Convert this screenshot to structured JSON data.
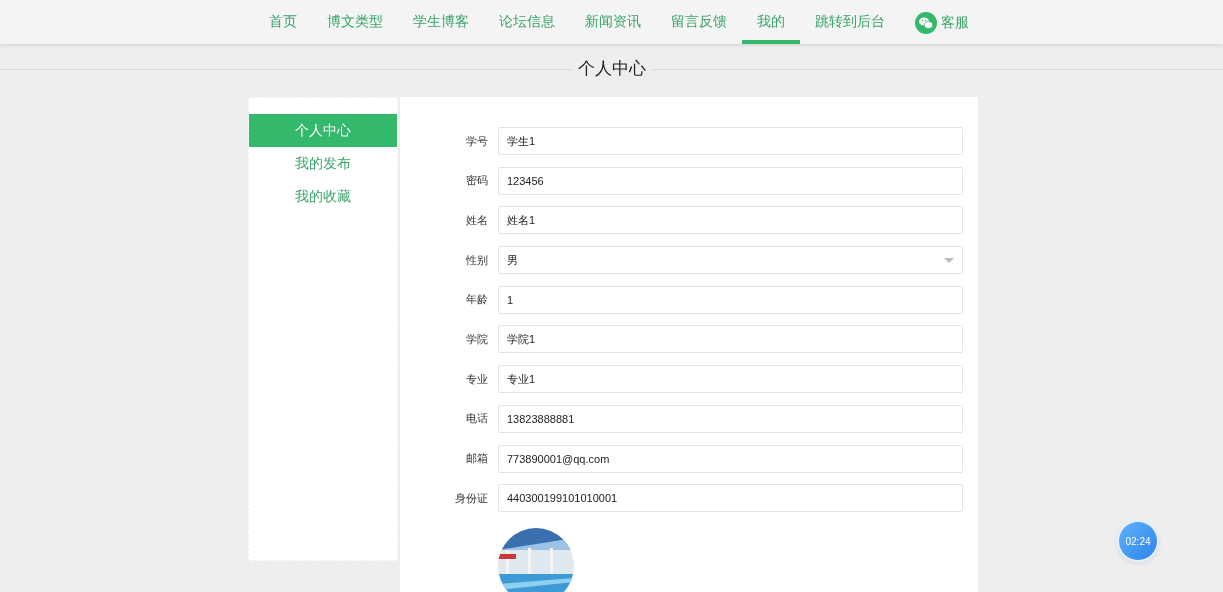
{
  "nav": [
    {
      "label": "首页",
      "selected": false,
      "kind": "link"
    },
    {
      "label": "博文类型",
      "selected": false,
      "kind": "link"
    },
    {
      "label": "学生博客",
      "selected": false,
      "kind": "link"
    },
    {
      "label": "论坛信息",
      "selected": false,
      "kind": "link"
    },
    {
      "label": "新闻资讯",
      "selected": false,
      "kind": "link"
    },
    {
      "label": "留言反馈",
      "selected": false,
      "kind": "link"
    },
    {
      "label": "我的",
      "selected": true,
      "kind": "link"
    },
    {
      "label": "跳转到后台",
      "selected": false,
      "kind": "link"
    },
    {
      "label": "客服",
      "selected": false,
      "kind": "chat"
    }
  ],
  "header": {
    "title": "个人中心"
  },
  "sidebar": {
    "items": [
      {
        "label": "个人中心",
        "selected": true
      },
      {
        "label": "我的发布",
        "selected": false
      },
      {
        "label": "我的收藏",
        "selected": false
      }
    ]
  },
  "form": {
    "fields": [
      {
        "label": "学号",
        "value": "学生1",
        "kind": "text"
      },
      {
        "label": "密码",
        "value": "123456",
        "kind": "text"
      },
      {
        "label": "姓名",
        "value": "姓名1",
        "kind": "text"
      },
      {
        "label": "性别",
        "value": "男",
        "kind": "select"
      },
      {
        "label": "年龄",
        "value": "1",
        "kind": "text"
      },
      {
        "label": "学院",
        "value": "学院1",
        "kind": "text"
      },
      {
        "label": "专业",
        "value": "专业1",
        "kind": "text"
      },
      {
        "label": "电话",
        "value": "13823888881",
        "kind": "text"
      },
      {
        "label": "邮箱",
        "value": "773890001@qq.com",
        "kind": "text"
      },
      {
        "label": "身份证",
        "value": "440300199101010001",
        "kind": "text"
      }
    ]
  },
  "timer": {
    "label": "02:24"
  }
}
